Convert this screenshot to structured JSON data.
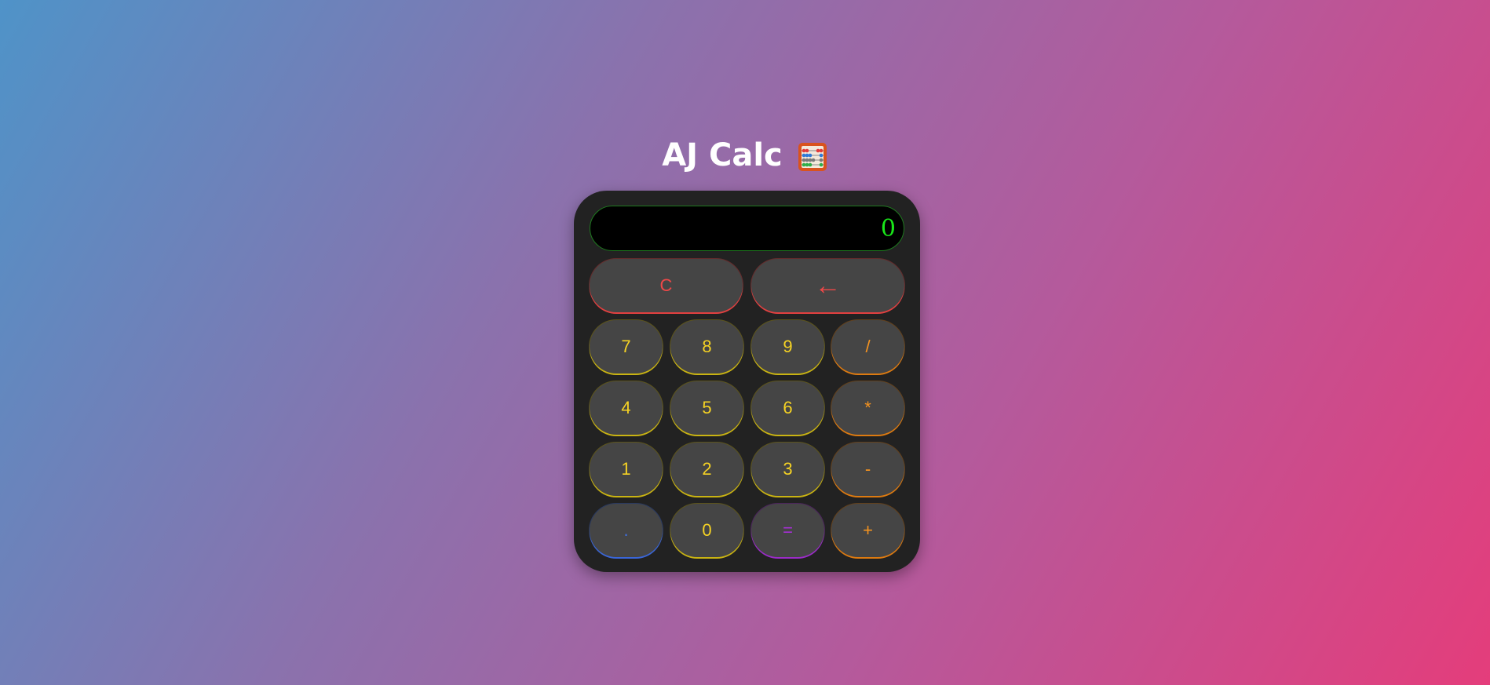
{
  "header": {
    "title": "AJ Calc",
    "icon": "abacus-icon"
  },
  "display": {
    "value": "0"
  },
  "colors": {
    "display_text": "#19e619",
    "clear": "#f04848",
    "digits": "#f5d224",
    "operators": "#f5931f",
    "decimal": "#3e6fe0",
    "equals": "#a62fd6"
  },
  "buttons": {
    "clear": "C",
    "backspace": "←",
    "seven": "7",
    "eight": "8",
    "nine": "9",
    "divide": "/",
    "four": "4",
    "five": "5",
    "six": "6",
    "multiply": "*",
    "one": "1",
    "two": "2",
    "three": "3",
    "subtract": "-",
    "decimal": ".",
    "zero": "0",
    "equals": "=",
    "add": "+"
  }
}
